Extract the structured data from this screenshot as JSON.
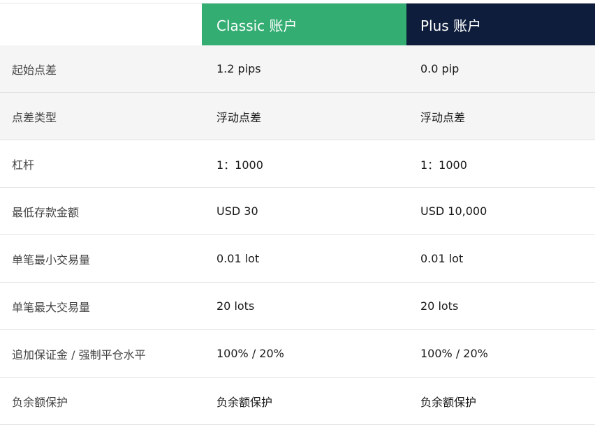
{
  "colors": {
    "classic_header_bg": "#34ad73",
    "plus_header_bg": "#0e1d3b"
  },
  "header": {
    "classic_label": "Classic 账户",
    "plus_label": "Plus 账户"
  },
  "rows": [
    {
      "label": "起始点差",
      "classic": "1.2 pips",
      "plus": "0.0 pip"
    },
    {
      "label": "点差类型",
      "classic": "浮动点差",
      "plus": "浮动点差"
    },
    {
      "label": "杠杆",
      "classic": "1：1000",
      "plus": "1：1000"
    },
    {
      "label": "最低存款金额",
      "classic": "USD 30",
      "plus": "USD 10,000"
    },
    {
      "label": "单笔最小交易量",
      "classic": "0.01 lot",
      "plus": "0.01 lot"
    },
    {
      "label": "单笔最大交易量",
      "classic": "20 lots",
      "plus": "20 lots"
    },
    {
      "label": "追加保证金 / 强制平仓水平",
      "classic": "100% / 20%",
      "plus": "100% / 20%"
    },
    {
      "label": "负余额保护",
      "classic": "负余额保护",
      "plus": "负余额保护"
    }
  ]
}
